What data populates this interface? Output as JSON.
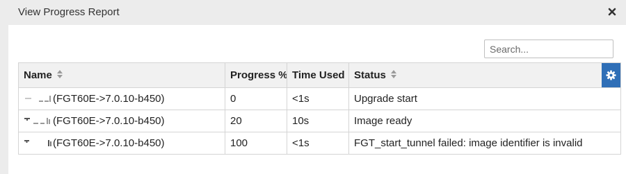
{
  "dialog": {
    "title": "View Progress Report",
    "close_icon": "close-icon"
  },
  "search": {
    "placeholder": "Search..."
  },
  "table": {
    "columns": [
      {
        "label": "Name"
      },
      {
        "label": "Progress %"
      },
      {
        "label": "Time Used"
      },
      {
        "label": "Status"
      }
    ],
    "settings_icon": "gear-icon",
    "rows": [
      {
        "name": "(FGT60E->7.0.10-b450)",
        "progress": "0",
        "time_used": "<1s",
        "status": "Upgrade start"
      },
      {
        "name": "(FGT60E->7.0.10-b450)",
        "progress": "20",
        "time_used": "10s",
        "status": "Image ready"
      },
      {
        "name": "(FGT60E->7.0.10-b450)",
        "progress": "100",
        "time_used": "<1s",
        "status": "FGT_start_tunnel failed: image identifier is invalid"
      }
    ]
  },
  "colors": {
    "accent": "#2f6fb7",
    "header_bg": "#f1f1f1",
    "titlebar_bg": "#ececec"
  }
}
